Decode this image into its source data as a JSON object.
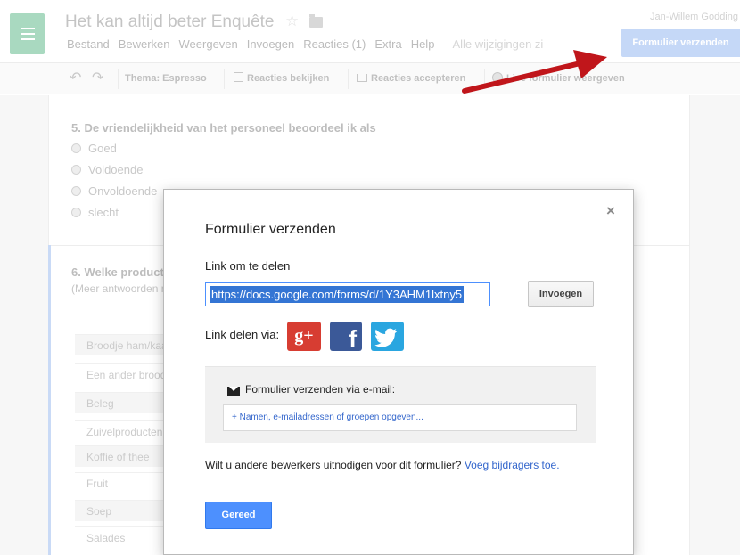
{
  "header": {
    "doc_title": "Het kan altijd beter Enquête",
    "user_name": "Jan-Willem Godding",
    "send_button": "Formulier verzenden",
    "menu": [
      "Bestand",
      "Bewerken",
      "Weergeven",
      "Invoegen",
      "Reacties (1)",
      "Extra",
      "Help"
    ],
    "saved_status": "Alle wijzigingen zi"
  },
  "toolbar": {
    "theme": "Thema: Espresso",
    "view_responses": "Reacties bekijken",
    "accept_responses": "Reacties accepteren",
    "view_form": "Live formulier weergeven"
  },
  "form": {
    "q5": {
      "title": "5. De vriendelijkheid van het personeel beoordeel ik als",
      "options": [
        "Goed",
        "Voldoende",
        "Onvoldoende",
        "slecht"
      ]
    },
    "q6": {
      "title": "6. Welke producten",
      "help": "(Meer antwoorden mogelijk)",
      "rows": [
        "Broodje ham/kaas",
        "Een ander broodje",
        "Beleg",
        "Zuivelproducten",
        "Koffie of thee",
        "Fruit",
        "Soep",
        "Salades"
      ]
    }
  },
  "dialog": {
    "title": "Formulier verzenden",
    "close_glyph": "×",
    "link_label": "Link om te delen",
    "link_value": "https://docs.google.com/forms/d/1Y3AHM1lxtny5",
    "insert_button": "Invoegen",
    "share_label": "Link delen via:",
    "gplus_glyph": "g+",
    "fb_glyph": "f",
    "email_label": "Formulier verzenden via e-mail:",
    "email_placeholder": "+ Namen, e-mailadressen of groepen opgeven...",
    "invite_text": "Wilt u andere bewerkers uitnodigen voor dit formulier?",
    "invite_link": "Voeg bijdragers toe.",
    "done_button": "Gereed"
  },
  "colors": {
    "accent_blue": "#4d90fe",
    "arrow_red": "#c0161b",
    "gplus": "#d73d32",
    "facebook": "#3b5998",
    "twitter": "#2aa6e0"
  }
}
